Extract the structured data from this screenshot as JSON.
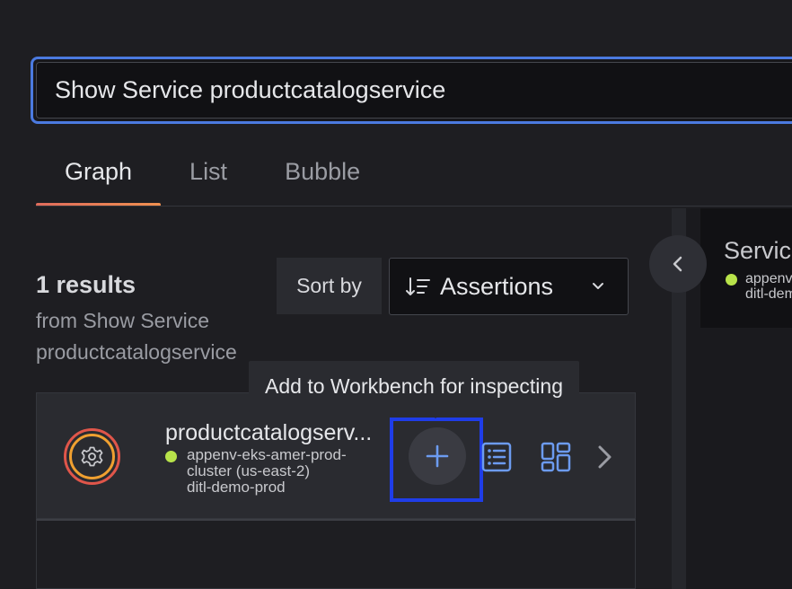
{
  "search": {
    "value": "Show Service productcatalogservice"
  },
  "tabs": [
    {
      "label": "Graph",
      "active": true
    },
    {
      "label": "List",
      "active": false
    },
    {
      "label": "Bubble",
      "active": false
    }
  ],
  "results": {
    "count_label": "1 results",
    "from_label": "from Show Service productcatalogservice",
    "sort_by_label": "Sort by",
    "sort_value": "Assertions"
  },
  "tooltip": {
    "text": "Add to Workbench for inspecting"
  },
  "card": {
    "name": "productcatalogserv...",
    "env_line1": "appenv-eks-amer-prod-",
    "env_line2": "cluster (us-east-2)",
    "env_line3": "ditl-demo-prod",
    "status_color": "#b8e34a"
  },
  "right_panel": {
    "title": "Service",
    "sub_line1": "appenv-",
    "sub_line2": "ditl-dem"
  },
  "colors": {
    "accent": "#4b7ae0",
    "highlight_box": "#1f3de8",
    "tab_underline": "#e06c5c",
    "icon_blue": "#6c9bf0",
    "status_green": "#b8e34a"
  },
  "icons": [
    "gear-icon",
    "plus-icon",
    "list-icon",
    "dashboard-icon",
    "chevron-right-icon",
    "chevron-left-icon",
    "chevron-down-icon",
    "sort-icon"
  ]
}
